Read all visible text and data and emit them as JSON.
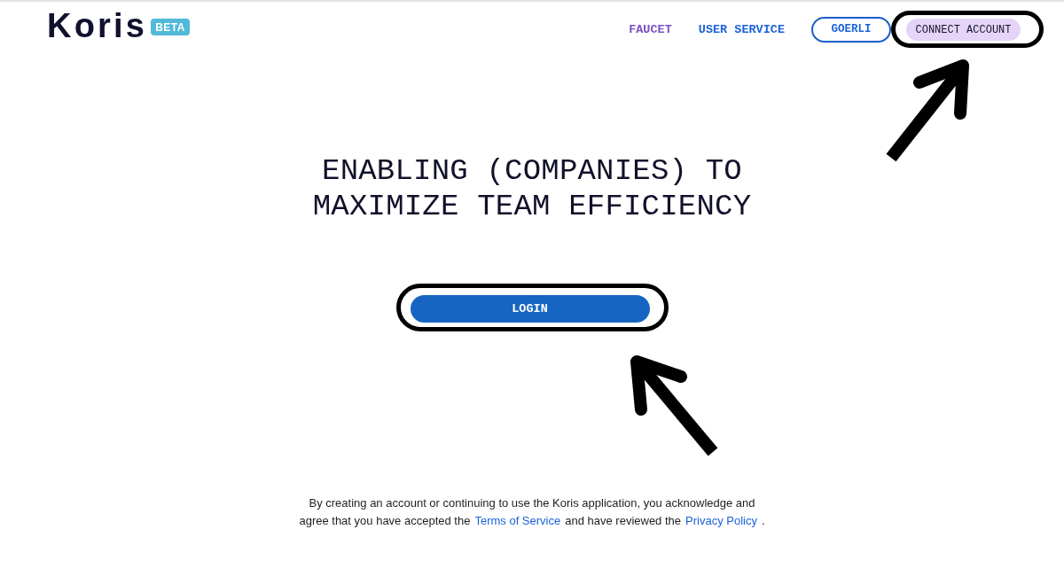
{
  "header": {
    "logo": "Koris",
    "badge": "BETA",
    "nav_links": [
      {
        "label": "FAUCET",
        "color": "#7b4fc0"
      },
      {
        "label": "USER SERVICE",
        "color": "#1b62d8"
      }
    ],
    "network_button": {
      "label": "GOERLI"
    },
    "connect_button": {
      "label": "CONNECT ACCOUNT",
      "highlighted": true,
      "arrow": {
        "kind": "up-right"
      }
    }
  },
  "hero": {
    "headline": "ENABLING (COMPANIES) TO MAXIMIZE TEAM EFFICIENCY",
    "login_button": {
      "label": "LOGIN",
      "highlighted": true,
      "arrow": {
        "kind": "up-left"
      }
    }
  },
  "legal_notice": [
    {
      "kind": "text",
      "text": "By creating an account or continuing to use the Koris application, you acknowledge and agree that you have accepted the"
    },
    {
      "kind": "link",
      "text": "Terms of Service"
    },
    {
      "kind": "text",
      "text": "and have reviewed the"
    },
    {
      "kind": "link",
      "text": "Privacy Policy"
    },
    {
      "kind": "text",
      "text": "."
    }
  ]
}
